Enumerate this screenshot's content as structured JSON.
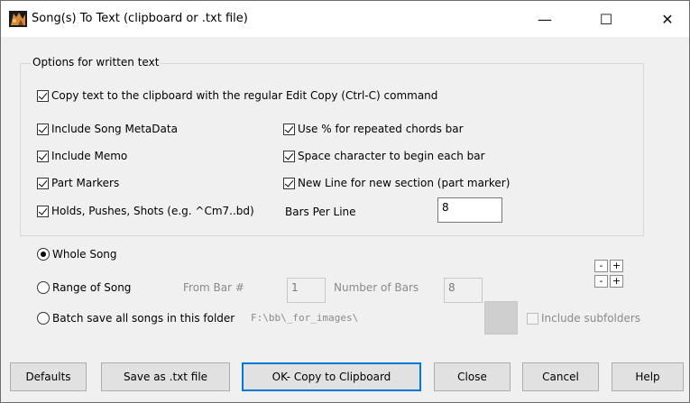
{
  "window": {
    "title": "Song(s) To Text (clipboard or .txt file)",
    "minimize_glyph": "—",
    "maximize_glyph": "☐",
    "close_glyph": "✕",
    "app_icon": "band-in-a-box-icon"
  },
  "options": {
    "group_label": "Options for written text",
    "copy_clipboard": "Copy text to the clipboard with the regular Edit Copy (Ctrl-C) command",
    "include_metadata": "Include Song MetaData",
    "include_memo": "Include Memo",
    "part_markers": "Part Markers",
    "holds_pushes": "Holds, Pushes, Shots (e.g. ^Cm7..bd)",
    "use_percent": "Use % for repeated chords bar",
    "space_char": "Space character to begin each bar",
    "new_line": "New Line for new section (part marker)",
    "bars_per_line_label": "Bars Per Line",
    "bars_per_line_value": "8"
  },
  "range": {
    "whole_song": "Whole Song",
    "range_of_song": "Range of Song",
    "from_bar_label": "From Bar #",
    "from_bar_value": "1",
    "number_of_bars_label": "Number of Bars",
    "number_of_bars_value": "8",
    "batch_save": "Batch save all songs in this folder",
    "folder_path": "F:\\bb\\_for_images\\",
    "include_subfolders": "Include subfolders",
    "minus": "-",
    "plus": "+"
  },
  "buttons": {
    "defaults": "Defaults",
    "save_txt": "Save as .txt file",
    "ok_copy": "OK- Copy to Clipboard",
    "close": "Close",
    "cancel": "Cancel",
    "help": "Help"
  },
  "colors": {
    "dialog_bg": "#f0f0f0",
    "titlebar_bg": "#ffffff",
    "default_button_border": "#0078d7"
  }
}
